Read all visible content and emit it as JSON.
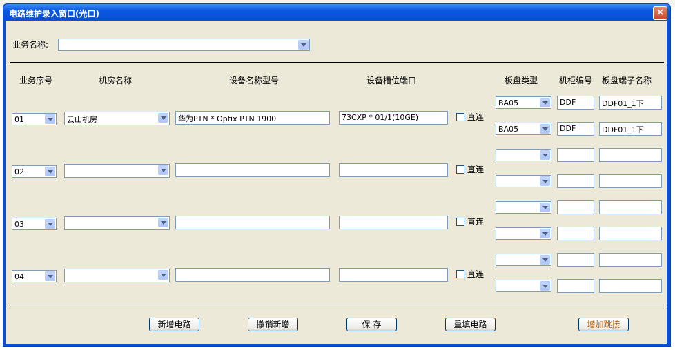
{
  "window": {
    "title": "电路维护录入窗口(光口)",
    "close_label": "×"
  },
  "service_name": {
    "label": "业务名称:",
    "value": ""
  },
  "headers": {
    "seq": "业务序号",
    "room": "机房名称",
    "device": "设备名称型号",
    "slot": "设备槽位端口",
    "board_type": "板盘类型",
    "cabinet": "机柜编号",
    "port_name": "板盘端子名称"
  },
  "rows": [
    {
      "seq": "01",
      "room": "云山机房",
      "device": "华为PTN * Optix PTN 1900",
      "slot": "73CXP * 01/1(10GE)",
      "direct": "直连",
      "sub": [
        {
          "board": "BA05",
          "cabinet": "DDF",
          "port": "DDF01_1下"
        },
        {
          "board": "BA05",
          "cabinet": "DDF",
          "port": "DDF01_1下"
        }
      ]
    },
    {
      "seq": "02",
      "room": "",
      "device": "",
      "slot": "",
      "direct": "直连",
      "sub": [
        {
          "board": "",
          "cabinet": "",
          "port": ""
        },
        {
          "board": "",
          "cabinet": "",
          "port": ""
        }
      ]
    },
    {
      "seq": "03",
      "room": "",
      "device": "",
      "slot": "",
      "direct": "直连",
      "sub": [
        {
          "board": "",
          "cabinet": "",
          "port": ""
        },
        {
          "board": "",
          "cabinet": "",
          "port": ""
        }
      ]
    },
    {
      "seq": "04",
      "room": "",
      "device": "",
      "slot": "",
      "direct": "直连",
      "sub": [
        {
          "board": "",
          "cabinet": "",
          "port": ""
        },
        {
          "board": "",
          "cabinet": "",
          "port": ""
        }
      ]
    }
  ],
  "buttons": {
    "add_circuit": "新增电路",
    "undo_add": "撤销新增",
    "save": "保 存",
    "refill": "重填电路",
    "add_jump": "增加跳接"
  },
  "colors": {
    "titlebar": "#0a4fd6",
    "client": "#ece9d8",
    "accent_button_text": "#b85b00"
  }
}
